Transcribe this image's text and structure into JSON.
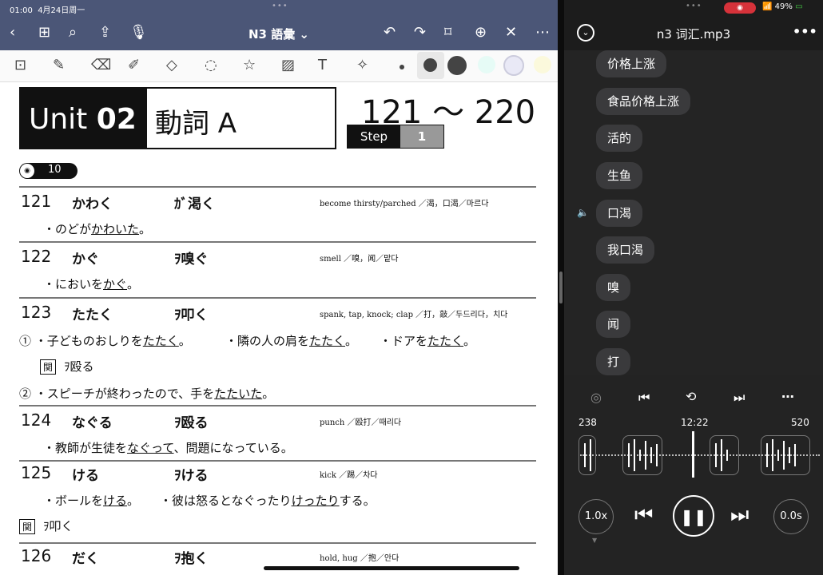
{
  "status_left": {
    "time": "01:00",
    "date": "4月24日周一"
  },
  "status_right": {
    "battery": "49%"
  },
  "doc_header": {
    "title": "N3 語彙 ⌄"
  },
  "page": {
    "unit_label": "Unit",
    "unit_num": "02",
    "unit_name": "動詞 A",
    "range": "121 ～ 220",
    "step_label": "Step",
    "step_num": "1",
    "track": "10"
  },
  "entries": [
    {
      "num": "121",
      "kana": "かわく",
      "kanji": "ｶﾞ渇く",
      "meaning": "become thirsty/parched ／渴，口渴／마르다"
    },
    {
      "num": "122",
      "kana": "かぐ",
      "kanji": "ｦ嗅ぐ",
      "meaning": "smell ／嗅，闻／맡다"
    },
    {
      "num": "123",
      "kana": "たたく",
      "kanji": "ｦ叩く",
      "meaning": "spank, tap, knock; clap ／打，敲／두드리다，치다"
    },
    {
      "num": "124",
      "kana": "なぐる",
      "kanji": "ｦ殴る",
      "meaning": "punch ／殴打／때리다"
    },
    {
      "num": "125",
      "kana": "ける",
      "kanji": "ｦける",
      "meaning": "kick ／踢／차다"
    },
    {
      "num": "126",
      "kana": "だく",
      "kanji": "ｦ抱く",
      "meaning": "hold, hug ／抱／안다"
    }
  ],
  "examples": {
    "e121": [
      "・のどが",
      "かわいた",
      "。"
    ],
    "e122": [
      "・においを",
      "かぐ",
      "。"
    ],
    "e123a": [
      "①  ・子どものおしりを",
      "たたく",
      "。"
    ],
    "e123b": [
      "・隣の人の肩を",
      "たたく",
      "。"
    ],
    "e123c": [
      "・ドアを",
      "たたく",
      "。"
    ],
    "rel_label": "関",
    "rel123": "ｦ殴る",
    "e123d": [
      "②  ・スピーチが終わったので、手を",
      "たたいた",
      "。"
    ],
    "e124": [
      "・教師が生徒を",
      "なぐって",
      "、問題になっている。"
    ],
    "e125a": [
      "・ボールを",
      "ける",
      "。"
    ],
    "e125b": [
      "・彼は怒るとなぐったり",
      "けったり",
      "する。"
    ],
    "rel125": "ｦ叩く"
  },
  "player": {
    "title": "n3 词汇.mp3",
    "left_marker": "238",
    "current_time": "12:22",
    "right_marker": "520",
    "speed": "1.0x",
    "offset": "0.0s"
  },
  "transcript": [
    {
      "text": "价格上涨"
    },
    {
      "text": "食品价格上涨"
    },
    {
      "text": "活的"
    },
    {
      "text": "生鱼"
    },
    {
      "text": "口渴",
      "playing": true
    },
    {
      "text": "我口渴"
    },
    {
      "text": "嗅"
    },
    {
      "text": "闻"
    },
    {
      "text": "打"
    }
  ],
  "colors": {
    "header": "#4b5677",
    "player_bg": "#242424",
    "record": "#d6323a"
  }
}
